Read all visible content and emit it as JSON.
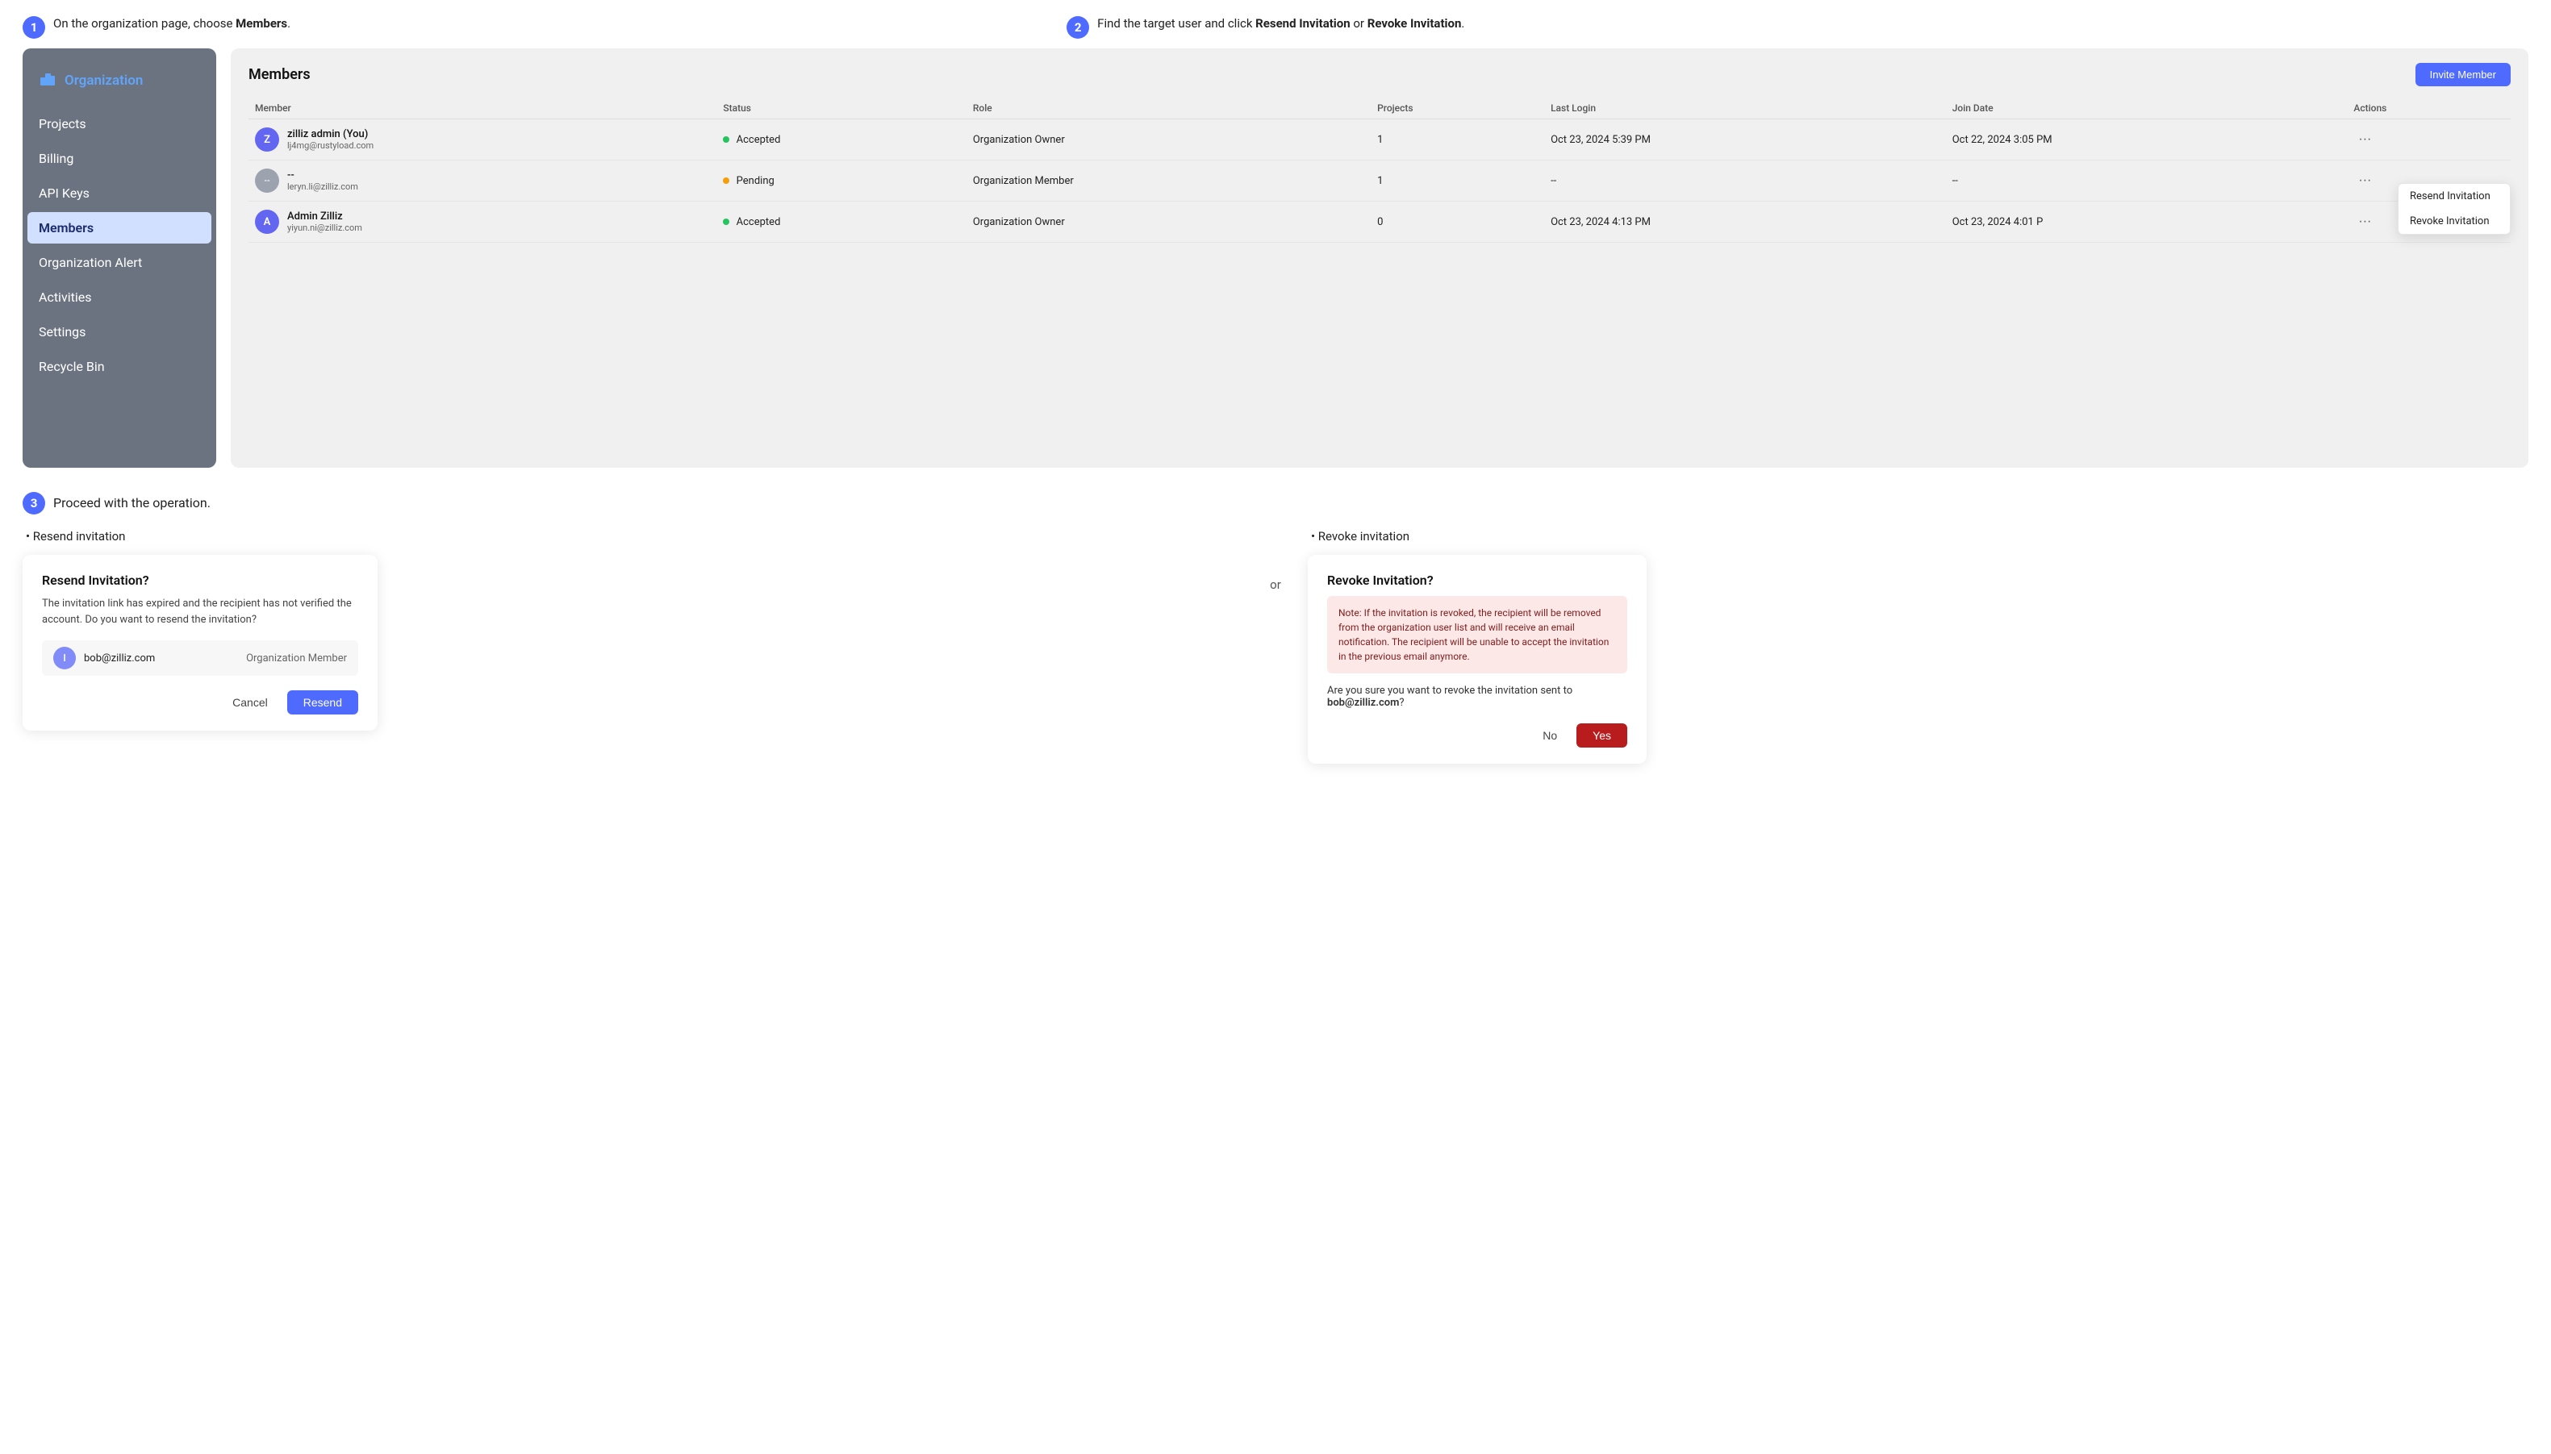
{
  "steps": [
    {
      "number": "1",
      "text_before": "On the organization page, choose ",
      "text_bold": "Members",
      "text_after": "."
    },
    {
      "number": "2",
      "text_before": "Find the target user and click ",
      "text_bold1": "Resend Invitation",
      "text_middle": " or ",
      "text_bold2": "Revoke Invitation",
      "text_after": "."
    }
  ],
  "sidebar": {
    "org_label": "Organization",
    "items": [
      {
        "label": "Projects",
        "active": false
      },
      {
        "label": "Billing",
        "active": false
      },
      {
        "label": "API Keys",
        "active": false
      },
      {
        "label": "Members",
        "active": true
      },
      {
        "label": "Organization Alert",
        "active": false
      },
      {
        "label": "Activities",
        "active": false
      },
      {
        "label": "Settings",
        "active": false
      },
      {
        "label": "Recycle Bin",
        "active": false
      }
    ]
  },
  "members_panel": {
    "title": "Members",
    "invite_button": "Invite Member",
    "columns": [
      "Member",
      "Status",
      "Role",
      "Projects",
      "Last Login",
      "Join Date",
      "Actions"
    ],
    "rows": [
      {
        "avatar_letter": "Z",
        "avatar_class": "avatar-z",
        "name": "zilliz admin (You)",
        "email": "lj4mg@rustyload.com",
        "status": "Accepted",
        "status_dot": "green",
        "role": "Organization Owner",
        "projects": "1",
        "last_login": "Oct 23, 2024 5:39 PM",
        "join_date": "Oct 22, 2024 3:05 PM"
      },
      {
        "avatar_letter": "--",
        "avatar_class": "avatar-dash",
        "name": "--",
        "email": "leryn.li@zilliz.com",
        "status": "Pending",
        "status_dot": "yellow",
        "role": "Organization Member",
        "projects": "1",
        "last_login": "--",
        "join_date": "--"
      },
      {
        "avatar_letter": "A",
        "avatar_class": "avatar-a",
        "name": "Admin Zilliz",
        "email": "yiyun.ni@zilliz.com",
        "status": "Accepted",
        "status_dot": "green",
        "role": "Organization Owner",
        "projects": "0",
        "last_login": "Oct 23, 2024 4:13 PM",
        "join_date": "Oct 23, 2024 4:01 P"
      }
    ],
    "dropdown": {
      "resend": "Resend Invitation",
      "revoke": "Revoke Invitation"
    }
  },
  "step3": {
    "number": "3",
    "text": "Proceed with the operation.",
    "col_left": {
      "bullet": "Resend invitation",
      "dialog_title": "Resend Invitation?",
      "dialog_desc": "The invitation link has expired and the recipient has not verified the account. Do you want to resend the invitation?",
      "user_email": "bob@zilliz.com",
      "user_role": "Organization Member",
      "user_avatar": "l",
      "cancel_label": "Cancel",
      "resend_label": "Resend"
    },
    "or_label": "or",
    "col_right": {
      "bullet": "Revoke invitation",
      "dialog_title": "Revoke Invitation?",
      "note": "Note: If the invitation is revoked, the recipient will be removed from the organization user list and will receive an email notification. The recipient will be unable to accept the invitation in the previous email anymore.",
      "confirm_text_before": "Are you sure you want to revoke the invitation sent to ",
      "confirm_email": "bob@zilliz.com",
      "confirm_text_after": "?",
      "no_label": "No",
      "yes_label": "Yes"
    }
  }
}
